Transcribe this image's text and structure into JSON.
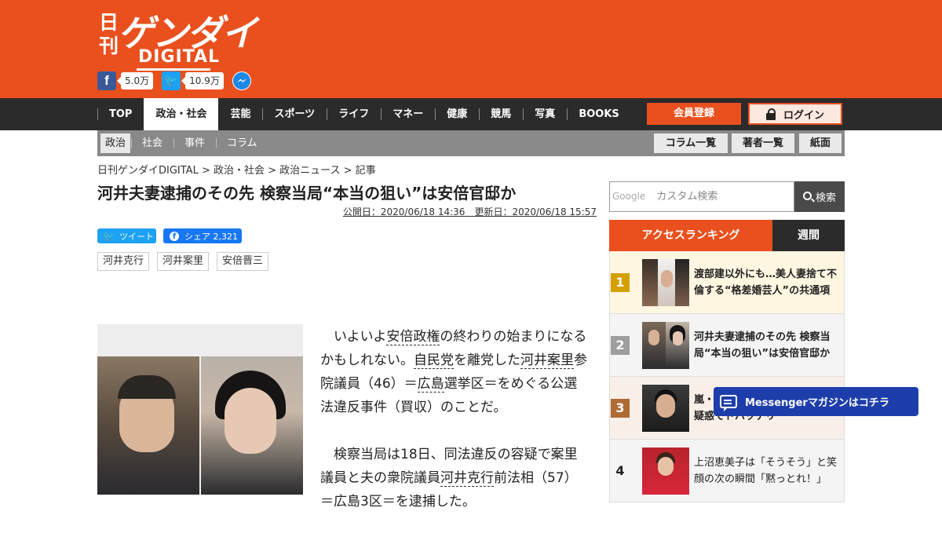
{
  "header": {
    "logo_kanji": "日刊",
    "logo_main": "ゲンダイ",
    "logo_sub": "DIGITAL",
    "facebook_count": "5.0万",
    "twitter_count": "10.9万",
    "brand_color": "#e9501e",
    "icons": [
      "facebook-icon",
      "twitter-icon",
      "messenger-icon"
    ]
  },
  "nav": {
    "items": [
      "TOP",
      "政治・社会",
      "芸能",
      "スポーツ",
      "ライフ",
      "マネー",
      "健康",
      "競馬",
      "写真",
      "BOOKS"
    ],
    "active_index": 1,
    "register": "会員登録",
    "login": "ログイン"
  },
  "subnav": {
    "items": [
      "政治",
      "社会",
      "事件",
      "コラム"
    ],
    "active_index": 0,
    "buttons": [
      "コラム一覧",
      "著者一覧",
      "紙面"
    ]
  },
  "breadcrumb": "日刊ゲンダイDIGITAL > 政治・社会 > 政治ニュース > 記事",
  "article": {
    "title": "河井夫妻逮捕のその先 検察当局“本当の狙い”は安倍官邸か",
    "published": "公開日：2020/06/18 14:36",
    "updated": "更新日：2020/06/18 15:57",
    "tweet_label": "ツイート",
    "share_label": "シェア 2,321",
    "tags": [
      "河井克行",
      "河井案里",
      "安倍晋三"
    ],
    "p1": {
      "a": "いよいよ",
      "kw1": "安倍政権",
      "b": "の終わりの始まりになるかもしれない。",
      "kw2": "自民党",
      "c": "を離党した",
      "kw3": "河井案里",
      "d": "参院議員（46）＝",
      "kw4": "広島",
      "e": "選挙区＝をめぐる公選法違反事件（買収）のことだ。"
    },
    "p2": {
      "a": "検察当局は18日、同法違反の容疑で案里議員と夫の衆院議員",
      "kw1": "河井克行",
      "b": "前法相（57）＝広島3区＝を逮捕した。"
    }
  },
  "sidebar": {
    "search_brand": "Google",
    "search_placeholder": "カスタム検索",
    "search_button": "検索",
    "ranking_tab": "アクセスランキング",
    "weekly_tab": "週間",
    "ranking": [
      {
        "rank": "1",
        "title": "渡部建以外にも…美人妻捨て不倫する“格差婚芸人”の共通項",
        "badge_color": "#d4a000"
      },
      {
        "rank": "2",
        "title": "河井夫妻逮捕のその先 検察当局“本当の狙い”は安倍官邸か",
        "badge_color": "#9e9e9e"
      },
      {
        "rank": "3",
        "title": "嵐・二宮和也 再びのゲス不倫疑惑でドハッテリ",
        "badge_color": "#b06a34"
      },
      {
        "rank": "4",
        "title": "上沼恵美子は「そうそう」と笑顔の次の瞬間「黙っとれ！」",
        "badge_color": "#f4f4f4"
      }
    ],
    "messenger_label": "Messengerマガジンはコチラ"
  }
}
